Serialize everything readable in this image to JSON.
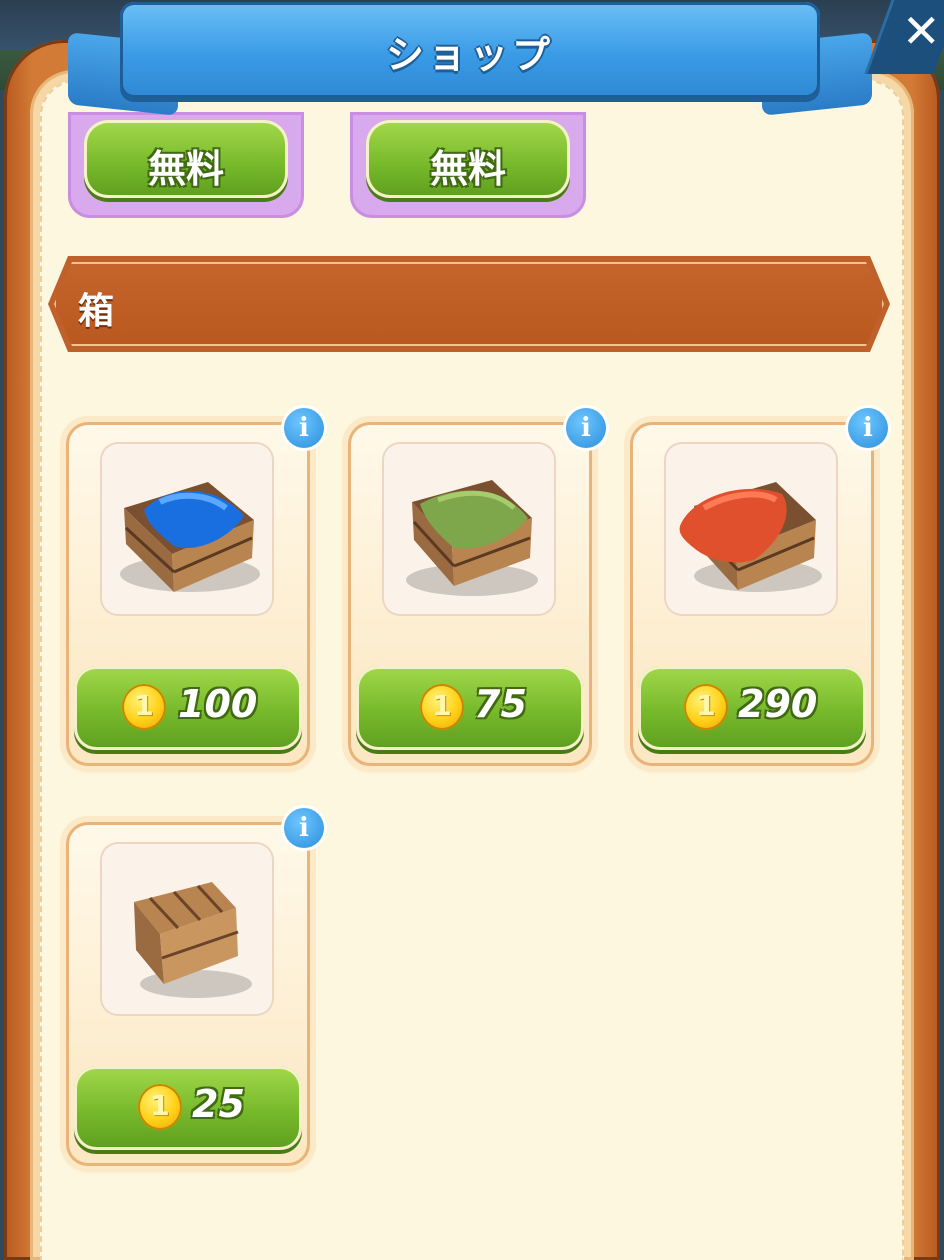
{
  "header": {
    "title": "ショップ",
    "close_icon": "close-icon"
  },
  "free_offers": [
    {
      "label": "無料"
    },
    {
      "label": "無料"
    }
  ],
  "section": {
    "label": "箱"
  },
  "products": [
    {
      "name": "blue-cloth-crate",
      "cloth_color": "#1a6fe0",
      "price": "100"
    },
    {
      "name": "green-cloth-crate",
      "cloth_color": "#7ea64a",
      "price": "75"
    },
    {
      "name": "red-cloth-crate",
      "cloth_color": "#e0502c",
      "price": "290"
    },
    {
      "name": "closed-crate",
      "cloth_color": "",
      "price": "25"
    }
  ],
  "icons": {
    "currency": "gold-coin-icon",
    "info": "info-icon"
  },
  "colors": {
    "accent_blue": "#3a9be6",
    "button_green": "#77b92b",
    "frame_orange": "#c0602a",
    "free_card_purple": "#d9a9ee"
  }
}
